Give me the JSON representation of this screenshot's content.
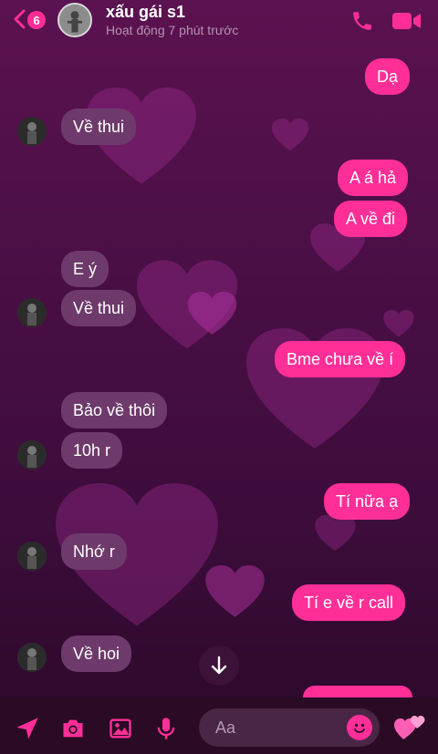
{
  "header": {
    "back_badge": "6",
    "contact_name": "xấu gái s1",
    "status": "Hoạt động 7 phút trước"
  },
  "messages": [
    {
      "side": "out",
      "text": "Dạ"
    },
    {
      "side": "in",
      "text": "Về thui"
    },
    {
      "side": "out",
      "text": "A á hả"
    },
    {
      "side": "out",
      "text": "A về đi"
    },
    {
      "side": "in",
      "text": "E ý"
    },
    {
      "side": "in",
      "text": "Về thui"
    },
    {
      "side": "out",
      "text": "Bme chưa về í"
    },
    {
      "side": "in",
      "text": "Bảo về thôi"
    },
    {
      "side": "in",
      "text": "10h r"
    },
    {
      "side": "out",
      "text": "Tí nữa ạ"
    },
    {
      "side": "in",
      "text": "Nhớ r"
    },
    {
      "side": "out",
      "text": "Tí e về r call"
    },
    {
      "side": "in",
      "text": "Về hoi"
    }
  ],
  "composer": {
    "placeholder": "Aa"
  },
  "colors": {
    "accent": "#ff2f97",
    "incoming_bubble": "#6e3a6b",
    "background": "#4a0f45"
  }
}
